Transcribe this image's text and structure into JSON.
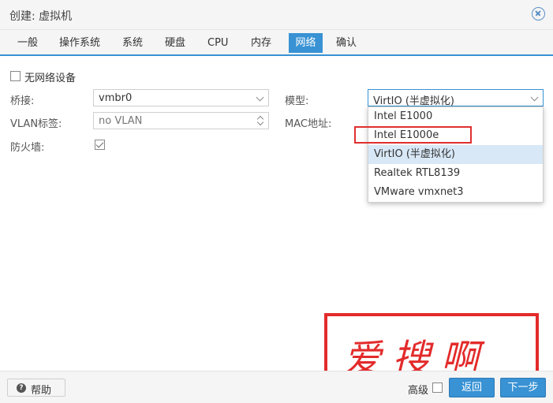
{
  "window": {
    "title": "创建: 虚拟机"
  },
  "tabs": [
    {
      "label": "一般"
    },
    {
      "label": "操作系统"
    },
    {
      "label": "系统"
    },
    {
      "label": "硬盘"
    },
    {
      "label": "CPU"
    },
    {
      "label": "内存"
    },
    {
      "label": "网络"
    },
    {
      "label": "确认"
    }
  ],
  "active_tab": "网络",
  "form": {
    "no_network_label": "无网络设备",
    "bridge_label": "桥接:",
    "bridge_value": "vmbr0",
    "vlan_label": "VLAN标签:",
    "vlan_value": "no VLAN",
    "firewall_label": "防火墙:",
    "model_label": "模型:",
    "model_value": "VirtIO (半虚拟化)",
    "mac_label": "MAC地址:"
  },
  "model_options": [
    {
      "label": "Intel E1000"
    },
    {
      "label": "Intel E1000e"
    },
    {
      "label": "VirtIO (半虚拟化)"
    },
    {
      "label": "Realtek RTL8139"
    },
    {
      "label": "VMware vmxnet3"
    }
  ],
  "highlighted_option": "Intel E1000e",
  "watermark": {
    "text": "爱搜啊"
  },
  "footer": {
    "help_label": "帮助",
    "advanced_label": "高级",
    "back_label": "返回",
    "next_label": "下一步"
  },
  "colors": {
    "accent": "#3892d4",
    "highlight": "#e03030"
  }
}
